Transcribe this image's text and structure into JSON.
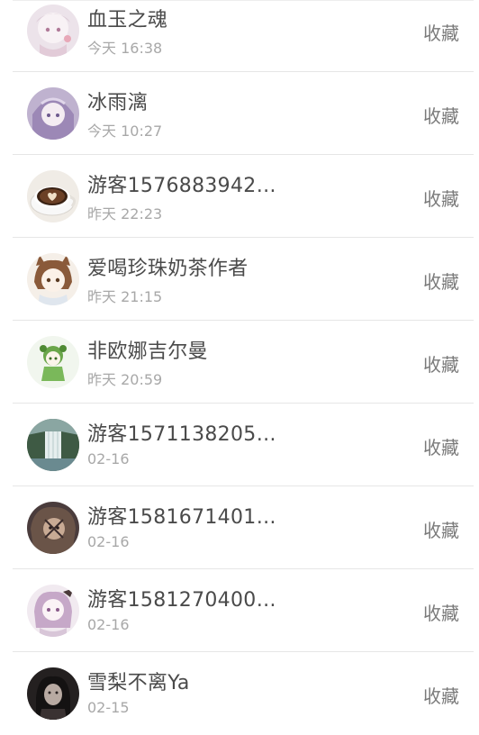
{
  "favorite_label": "收藏",
  "users": [
    {
      "name": "血玉之魂",
      "time": "今天 16:38",
      "avatar_icon": "anime-girl-white-hair-avatar",
      "avatar_bg": "#e9dfe6",
      "avatar_fg": "#c8a8b8"
    },
    {
      "name": "冰雨漓",
      "time": "今天 10:27",
      "avatar_icon": "anime-girl-purple-avatar",
      "avatar_bg": "#c9bdd6",
      "avatar_fg": "#8e7aa8"
    },
    {
      "name": "游客1576883942…",
      "time": "昨天 22:23",
      "avatar_icon": "coffee-cup-heart-avatar",
      "avatar_bg": "#e8e2da",
      "avatar_fg": "#3b2416"
    },
    {
      "name": "爱喝珍珠奶茶作者",
      "time": "昨天 21:15",
      "avatar_icon": "anime-catgirl-avatar",
      "avatar_bg": "#f2ebe4",
      "avatar_fg": "#8a5a3a"
    },
    {
      "name": "非欧娜吉尔曼",
      "time": "昨天 20:59",
      "avatar_icon": "anime-green-girl-avatar",
      "avatar_bg": "#eef4ea",
      "avatar_fg": "#6aa64a"
    },
    {
      "name": "游客1571138205…",
      "time": "02-16",
      "avatar_icon": "waterfall-landscape-avatar",
      "avatar_bg": "#6c8470",
      "avatar_fg": "#dfe8e6"
    },
    {
      "name": "游客1581671401…",
      "time": "02-16",
      "avatar_icon": "dark-anime-character-avatar",
      "avatar_bg": "#5a4a4a",
      "avatar_fg": "#9a8070"
    },
    {
      "name": "游客1581270400…",
      "time": "02-16",
      "avatar_icon": "anime-girl-pink-hair-avatar",
      "avatar_bg": "#efe7ee",
      "avatar_fg": "#b79ab8"
    },
    {
      "name": "雪梨不离Ya",
      "time": "02-15",
      "avatar_icon": "dark-portrait-avatar",
      "avatar_bg": "#2a2626",
      "avatar_fg": "#6a5e58"
    }
  ]
}
